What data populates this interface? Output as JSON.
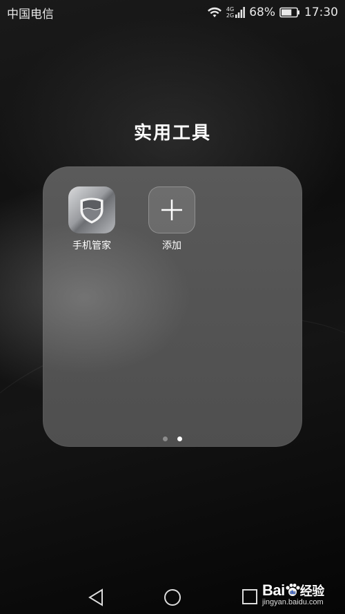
{
  "status_bar": {
    "carrier": "中国电信",
    "network_top": "4G",
    "network_bottom": "2G",
    "battery_percent": "68%",
    "time": "17:30",
    "battery_level": 0.68
  },
  "folder": {
    "title": "实用工具",
    "apps": [
      {
        "label": "手机管家",
        "icon": "shield-icon"
      },
      {
        "label": "添加",
        "icon": "plus-icon"
      }
    ],
    "page_count": 2,
    "active_page": 2
  },
  "nav": {
    "back_icon": "back-triangle-icon",
    "home_icon": "home-circle-icon",
    "recent_icon": "recent-square-icon"
  },
  "watermark": {
    "logo_text_left": "Bai",
    "logo_text_right": "经验",
    "url": "jingyan.baidu.com"
  }
}
